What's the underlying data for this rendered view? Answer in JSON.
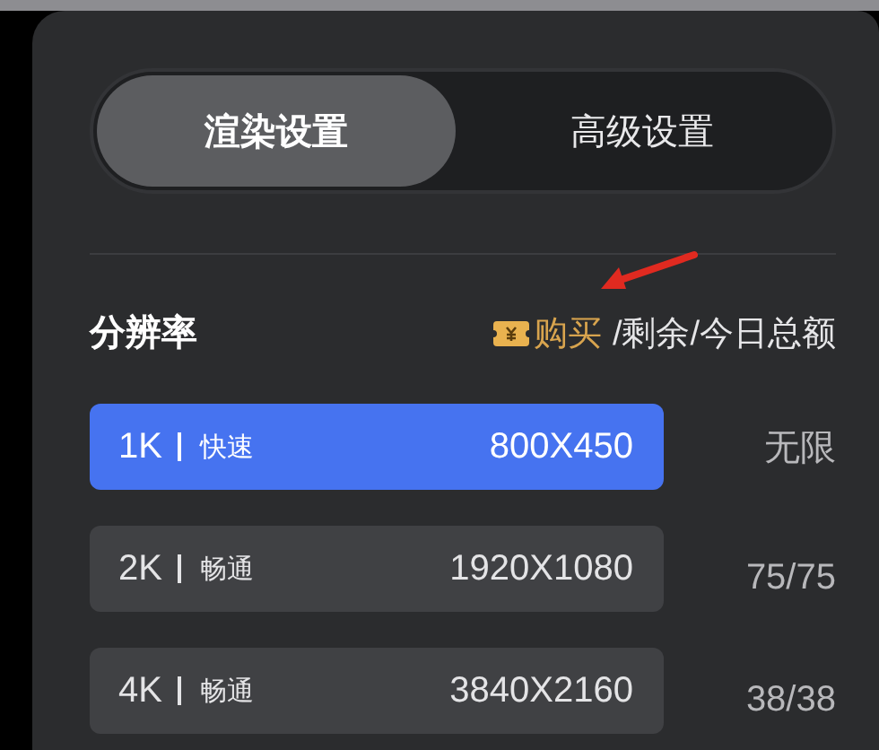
{
  "tabs": [
    {
      "label": "渲染设置",
      "selected": true
    },
    {
      "label": "高级设置",
      "selected": false
    }
  ],
  "resolution": {
    "title": "分辨率",
    "buy_label": "购买",
    "quota_label": "/剩余/今日总额",
    "options": [
      {
        "tier": "1K",
        "speed": "快速",
        "size": "800X450",
        "quota": "无限",
        "selected": true
      },
      {
        "tier": "2K",
        "speed": "畅通",
        "size": "1920X1080",
        "quota": "75/75",
        "selected": false
      },
      {
        "tier": "4K",
        "speed": "畅通",
        "size": "3840X2160",
        "quota": "38/38",
        "selected": false
      }
    ]
  }
}
